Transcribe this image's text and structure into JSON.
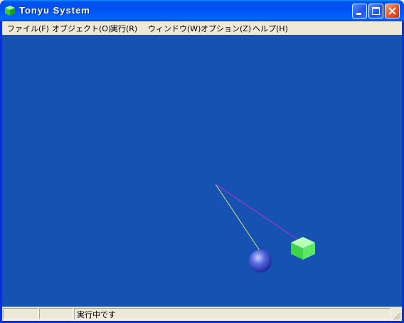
{
  "window": {
    "title": "Tonyu System",
    "icon": "green-cube-icon",
    "buttons": {
      "minimize": "minimize-icon",
      "maximize": "maximize-icon",
      "close": "close-icon"
    }
  },
  "menubar": {
    "items": [
      {
        "label": "ファイル(F)"
      },
      {
        "label": "オブジェクト(O)"
      },
      {
        "label": "実行(R)"
      },
      {
        "label": "ウィンドウ(W)"
      },
      {
        "label": "オプション(Z)"
      },
      {
        "label": "ヘルプ(H)"
      }
    ]
  },
  "canvas": {
    "background": "#1652b2",
    "yellow_line_color": "#e0e070",
    "magenta_line_color": "#c030d0",
    "sphere_color": "#5a6ae0",
    "cube_color": "#58e858"
  },
  "statusbar": {
    "panes": [
      "",
      ""
    ],
    "text": "実行中です"
  }
}
